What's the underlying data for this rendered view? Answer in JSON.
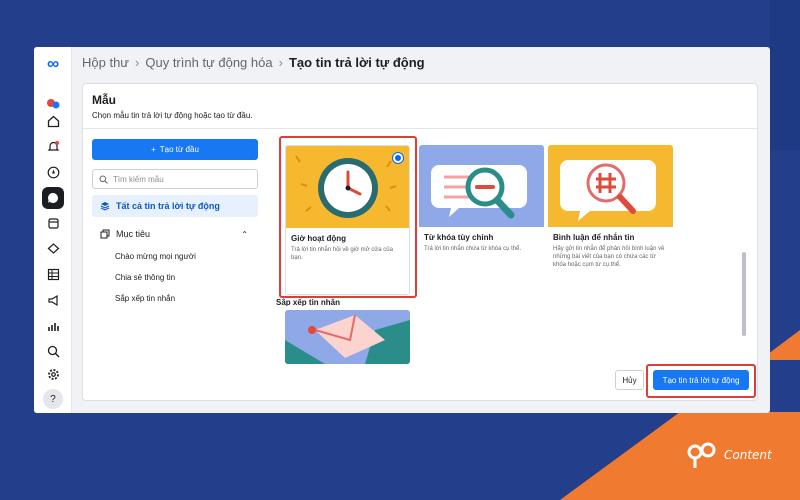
{
  "breadcrumb": {
    "items": [
      "Hộp thư",
      "Quy trình tự động hóa",
      "Tạo tin trả lời tự động"
    ]
  },
  "panel": {
    "title": "Mẫu",
    "subtitle": "Chọn mẫu tin trả lời tự động hoặc tạo từ đầu."
  },
  "left": {
    "create_label": "Tạo từ đầu",
    "search_placeholder": "Tìm kiếm mẫu",
    "all_label": "Tất cả tin trả lời tự động",
    "section_label": "Mục tiêu",
    "sub_items": [
      "Chào mừng mọi người",
      "Chia sẻ thông tin",
      "Sắp xếp tin nhắn"
    ]
  },
  "cards": [
    {
      "title": "Giờ hoạt động",
      "desc": "Trả lời tin nhắn hỏi về giờ mở cửa của bạn.",
      "selected": true,
      "color": "#f5b82e"
    },
    {
      "title": "Từ khóa tùy chỉnh",
      "desc": "Trả lời tin nhắn chứa từ khóa cụ thể.",
      "selected": false,
      "color": "#8ea8e8"
    },
    {
      "title": "Bình luận để nhắn tin",
      "desc": "Hãy gửi tin nhắn để phản hồi bình luận về những bài viết của bạn có chứa các từ khóa hoặc cụm từ cụ thể.",
      "selected": false,
      "color": "#f5b82e"
    }
  ],
  "section2": {
    "label": "Sắp xếp tin nhắn"
  },
  "footer": {
    "cancel_label": "Hủy",
    "primary_label": "Tạo tin trả lời tự động"
  },
  "brand": {
    "text": "Content"
  },
  "colors": {
    "accent": "#1877f2",
    "highlight": "#e03c3c"
  }
}
